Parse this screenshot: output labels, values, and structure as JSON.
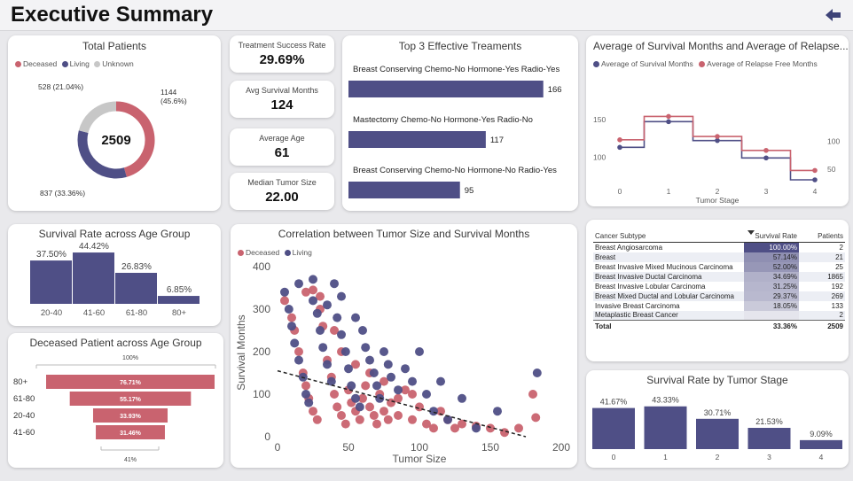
{
  "page": {
    "title": "Executive Summary"
  },
  "colors": {
    "deceased": "#c9636f",
    "living": "#4f4f86",
    "unknown": "#c7c7c7",
    "bar": "#4f4f86",
    "funnel": "#c9636f"
  },
  "total_patients": {
    "title": "Total Patients",
    "legend": [
      {
        "label": "Deceased",
        "color": "#c9636f"
      },
      {
        "label": "Living",
        "color": "#4f4f86"
      },
      {
        "label": "Unknown",
        "color": "#c7c7c7"
      }
    ],
    "center": "2509",
    "label_deceased_1": "1144",
    "label_deceased_2": "(45.6%)",
    "label_living": "837 (33.36%)",
    "label_unknown": "528 (21.04%)"
  },
  "kpis": {
    "success_rate": {
      "label": "Treatment Success Rate",
      "value": "29.69%"
    },
    "avg_survival": {
      "label": "Avg Survival Months",
      "value": "124"
    },
    "avg_age": {
      "label": "Average Age",
      "value": "61"
    },
    "median_tumor": {
      "label": "Median Tumor Size",
      "value": "22.00"
    }
  },
  "top_treatments": {
    "title": "Top 3 Effective Treaments",
    "items": [
      {
        "label": "Breast Conserving Chemo-No Hormone-Yes Radio-Yes",
        "value": "166"
      },
      {
        "label": "Mastectomy Chemo-No Hormone-Yes Radio-No",
        "value": "117"
      },
      {
        "label": "Breast Conserving Chemo-No Hormone-No Radio-Yes",
        "value": "95"
      }
    ]
  },
  "survival_relapse": {
    "title": "Average of Survival Months and Average of Relapse...",
    "legend_survival": "Average of Survival Months",
    "legend_relapse": "Average of Relapse Free Months",
    "xlabel": "Tumor Stage",
    "x_ticks": [
      "0",
      "1",
      "2",
      "3",
      "4"
    ],
    "y_left_ticks": [
      "100",
      "150"
    ],
    "y_right_ticks": [
      "50",
      "100"
    ]
  },
  "age_survival": {
    "title": "Survival Rate across Age Group",
    "labels": [
      "37.50%",
      "44.42%",
      "26.83%",
      "6.85%"
    ],
    "categories": [
      "20-40",
      "41-60",
      "61-80",
      "80+"
    ]
  },
  "deceased_age": {
    "title": "Deceased Patient across Age Group",
    "top_label": "100%",
    "bottom_label": "41%",
    "categories": [
      "80+",
      "61-80",
      "20-40",
      "41-60"
    ],
    "labels": [
      "76.71%",
      "55.17%",
      "33.93%",
      "31.46%"
    ]
  },
  "scatter": {
    "title": "Correlation between Tumor Size and Survival Months",
    "legend_deceased": "Deceased",
    "legend_living": "Living",
    "xlabel": "Tumor Size",
    "ylabel": "Survival Months",
    "x_ticks": [
      "0",
      "50",
      "100",
      "150",
      "200"
    ],
    "y_ticks": [
      "0",
      "100",
      "200",
      "300",
      "400"
    ]
  },
  "subtype_table": {
    "headers": [
      "Cancer Subtype",
      "Survival Rate",
      "Patients"
    ],
    "rows": [
      {
        "name": "Breast Angiosarcoma",
        "rate": "100.00%",
        "patients": "2"
      },
      {
        "name": "Breast",
        "rate": "57.14%",
        "patients": "21"
      },
      {
        "name": "Breast Invasive Mixed Mucinous Carcinoma",
        "rate": "52.00%",
        "patients": "25"
      },
      {
        "name": "Breast Invasive Ductal Carcinoma",
        "rate": "34.69%",
        "patients": "1865"
      },
      {
        "name": "Breast Invasive Lobular Carcinoma",
        "rate": "31.25%",
        "patients": "192"
      },
      {
        "name": "Breast Mixed Ductal and Lobular Carcinoma",
        "rate": "29.37%",
        "patients": "269"
      },
      {
        "name": "Invasive Breast Carcinoma",
        "rate": "18.05%",
        "patients": "133"
      },
      {
        "name": "Metaplastic Breast Cancer",
        "rate": "",
        "patients": "2"
      }
    ],
    "total": {
      "name": "Total",
      "rate": "33.36%",
      "patients": "2509"
    }
  },
  "stage_survival": {
    "title": "Survival Rate by Tumor Stage",
    "labels": [
      "41.67%",
      "43.33%",
      "30.71%",
      "21.53%",
      "9.09%"
    ],
    "categories": [
      "0",
      "1",
      "2",
      "3",
      "4"
    ]
  },
  "chart_data": [
    {
      "type": "pie",
      "title": "Total Patients",
      "categories": [
        "Deceased",
        "Living",
        "Unknown"
      ],
      "values": [
        1144,
        837,
        528
      ],
      "total": 2509
    },
    {
      "type": "bar",
      "orientation": "horizontal",
      "title": "Top 3 Effective Treaments",
      "categories": [
        "Breast Conserving Chemo-No Hormone-Yes Radio-Yes",
        "Mastectomy Chemo-No Hormone-Yes Radio-No",
        "Breast Conserving Chemo-No Hormone-No Radio-Yes"
      ],
      "values": [
        166,
        117,
        95
      ]
    },
    {
      "type": "line",
      "step": true,
      "title": "Average of Survival Months and Average of Relapse...",
      "xlabel": "Tumor Stage",
      "x": [
        0,
        1,
        2,
        3,
        4
      ],
      "series": [
        {
          "name": "Average of Survival Months",
          "axis": "left",
          "values": [
            113,
            147,
            122,
            99,
            70
          ]
        },
        {
          "name": "Average of Relapse Free Months",
          "axis": "right",
          "values": [
            103,
            145,
            109,
            84,
            48
          ]
        }
      ],
      "ylim_left": [
        70,
        165
      ],
      "ylim_right": [
        20,
        160
      ]
    },
    {
      "type": "bar",
      "title": "Survival Rate across Age Group",
      "categories": [
        "20-40",
        "41-60",
        "61-80",
        "80+"
      ],
      "values": [
        37.5,
        44.42,
        26.83,
        6.85
      ]
    },
    {
      "type": "bar",
      "orientation": "funnel",
      "title": "Deceased Patient across Age Group",
      "categories": [
        "80+",
        "61-80",
        "20-40",
        "41-60"
      ],
      "values": [
        76.71,
        55.17,
        33.93,
        31.46
      ]
    },
    {
      "type": "scatter",
      "title": "Correlation between Tumor Size and Survival Months",
      "xlabel": "Tumor Size",
      "ylabel": "Survival Months",
      "xlim": [
        0,
        200
      ],
      "ylim": [
        0,
        400
      ],
      "series": [
        {
          "name": "Deceased",
          "points": [
            [
              5,
              320
            ],
            [
              10,
              280
            ],
            [
              12,
              250
            ],
            [
              15,
              200
            ],
            [
              18,
              150
            ],
            [
              20,
              120
            ],
            [
              22,
              90
            ],
            [
              25,
              60
            ],
            [
              28,
              40
            ],
            [
              30,
              330
            ],
            [
              32,
              260
            ],
            [
              35,
              180
            ],
            [
              38,
              140
            ],
            [
              40,
              100
            ],
            [
              42,
              70
            ],
            [
              45,
              50
            ],
            [
              48,
              30
            ],
            [
              50,
              110
            ],
            [
              52,
              80
            ],
            [
              55,
              60
            ],
            [
              58,
              40
            ],
            [
              60,
              90
            ],
            [
              62,
              120
            ],
            [
              65,
              70
            ],
            [
              68,
              50
            ],
            [
              70,
              30
            ],
            [
              72,
              100
            ],
            [
              75,
              60
            ],
            [
              78,
              40
            ],
            [
              80,
              80
            ],
            [
              85,
              50
            ],
            [
              90,
              110
            ],
            [
              95,
              40
            ],
            [
              100,
              70
            ],
            [
              105,
              30
            ],
            [
              110,
              20
            ],
            [
              115,
              60
            ],
            [
              120,
              40
            ],
            [
              125,
              20
            ],
            [
              130,
              30
            ],
            [
              140,
              25
            ],
            [
              150,
              20
            ],
            [
              160,
              10
            ],
            [
              170,
              20
            ],
            [
              180,
              100
            ],
            [
              182,
              45
            ],
            [
              20,
              340
            ],
            [
              25,
              345
            ],
            [
              30,
              300
            ],
            [
              40,
              250
            ],
            [
              45,
              200
            ],
            [
              55,
              170
            ],
            [
              65,
              150
            ],
            [
              75,
              130
            ],
            [
              85,
              90
            ],
            [
              95,
              100
            ]
          ]
        },
        {
          "name": "Living",
          "points": [
            [
              5,
              340
            ],
            [
              8,
              300
            ],
            [
              10,
              260
            ],
            [
              12,
              220
            ],
            [
              15,
              180
            ],
            [
              18,
              140
            ],
            [
              20,
              100
            ],
            [
              22,
              80
            ],
            [
              25,
              320
            ],
            [
              28,
              290
            ],
            [
              30,
              250
            ],
            [
              32,
              210
            ],
            [
              35,
              170
            ],
            [
              38,
              130
            ],
            [
              40,
              360
            ],
            [
              42,
              280
            ],
            [
              45,
              240
            ],
            [
              48,
              200
            ],
            [
              50,
              160
            ],
            [
              52,
              120
            ],
            [
              55,
              90
            ],
            [
              58,
              70
            ],
            [
              60,
              250
            ],
            [
              62,
              210
            ],
            [
              65,
              180
            ],
            [
              68,
              150
            ],
            [
              70,
              120
            ],
            [
              72,
              90
            ],
            [
              75,
              200
            ],
            [
              78,
              170
            ],
            [
              80,
              140
            ],
            [
              85,
              110
            ],
            [
              90,
              160
            ],
            [
              95,
              130
            ],
            [
              100,
              200
            ],
            [
              105,
              100
            ],
            [
              110,
              60
            ],
            [
              115,
              130
            ],
            [
              120,
              40
            ],
            [
              130,
              90
            ],
            [
              140,
              20
            ],
            [
              155,
              60
            ],
            [
              183,
              150
            ],
            [
              15,
              360
            ],
            [
              25,
              370
            ],
            [
              35,
              310
            ],
            [
              45,
              330
            ],
            [
              55,
              280
            ]
          ]
        }
      ],
      "trendline": [
        [
          0,
          155
        ],
        [
          175,
          0
        ]
      ]
    },
    {
      "type": "table",
      "columns": [
        "Cancer Subtype",
        "Survival Rate",
        "Patients"
      ],
      "rows": [
        [
          "Breast Angiosarcoma",
          "100.00%",
          2
        ],
        [
          "Breast",
          "57.14%",
          21
        ],
        [
          "Breast Invasive Mixed Mucinous Carcinoma",
          "52.00%",
          25
        ],
        [
          "Breast Invasive Ductal Carcinoma",
          "34.69%",
          1865
        ],
        [
          "Breast Invasive Lobular Carcinoma",
          "31.25%",
          192
        ],
        [
          "Breast Mixed Ductal and Lobular Carcinoma",
          "29.37%",
          269
        ],
        [
          "Invasive Breast Carcinoma",
          "18.05%",
          133
        ],
        [
          "Metaplastic Breast Cancer",
          "",
          2
        ],
        [
          "Total",
          "33.36%",
          2509
        ]
      ]
    },
    {
      "type": "bar",
      "title": "Survival Rate by Tumor Stage",
      "categories": [
        "0",
        "1",
        "2",
        "3",
        "4"
      ],
      "values": [
        41.67,
        43.33,
        30.71,
        21.53,
        9.09
      ]
    }
  ]
}
